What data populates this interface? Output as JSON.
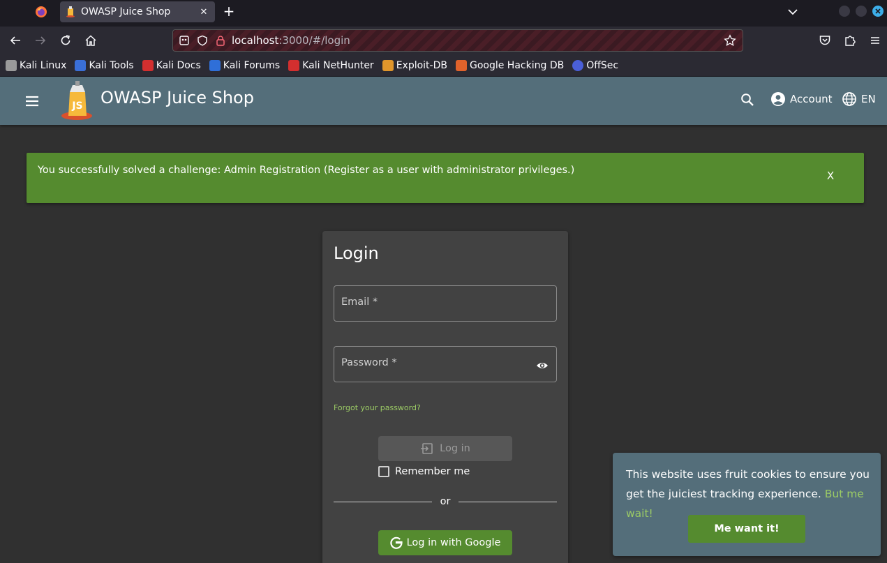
{
  "browser": {
    "tab_title": "OWASP Juice Shop",
    "url_host": "localhost",
    "url_rest": ":3000/#/login",
    "bookmarks": [
      {
        "label": "Kali Linux",
        "icon": "kali-dragon-icon",
        "color": "#9a9a9a"
      },
      {
        "label": "Kali Tools",
        "icon": "kali-tools-icon",
        "color": "#3a6fd8"
      },
      {
        "label": "Kali Docs",
        "icon": "kali-docs-icon",
        "color": "#d32f2f"
      },
      {
        "label": "Kali Forums",
        "icon": "kali-forums-icon",
        "color": "#2f6fd8"
      },
      {
        "label": "Kali NetHunter",
        "icon": "kali-nethunter-icon",
        "color": "#d32f2f"
      },
      {
        "label": "Exploit-DB",
        "icon": "exploit-db-icon",
        "color": "#e0962b"
      },
      {
        "label": "Google Hacking DB",
        "icon": "ghdb-icon",
        "color": "#e0622b"
      },
      {
        "label": "OffSec",
        "icon": "offsec-icon",
        "color": "#4a5fd8"
      }
    ]
  },
  "app": {
    "title": "OWASP Juice Shop",
    "account_label": "Account",
    "language_label": "EN"
  },
  "notification": {
    "text": "You successfully solved a challenge: Admin Registration (Register as a user with administrator privileges.)",
    "close_label": "X"
  },
  "login": {
    "title": "Login",
    "email_label": "Email *",
    "password_label": "Password *",
    "forgot_link": "Forgot your password?",
    "login_button": "Log in",
    "remember_me": "Remember me",
    "divider": "or",
    "google_button": "Log in with Google"
  },
  "cookie": {
    "text": "This website uses fruit cookies to ensure you get the juiciest tracking experience.",
    "link": "But me wait!",
    "button": "Me want it!"
  },
  "colors": {
    "toolbar": "#546e7a",
    "accent": "#558b2f",
    "link": "#9ccc65",
    "background": "#303030",
    "card": "#424242"
  }
}
